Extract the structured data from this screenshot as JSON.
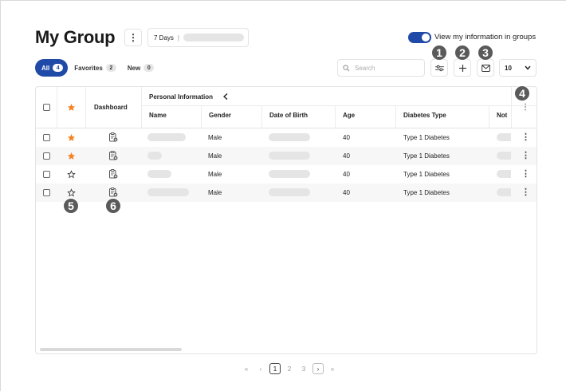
{
  "header": {
    "title": "My Group",
    "range_label": "7 Days",
    "range_separator": "|",
    "toggle_label": "View my information in groups",
    "toggle_on": true
  },
  "tabs": [
    {
      "label": "All",
      "count": "4",
      "active": true
    },
    {
      "label": "Favorites",
      "count": "2",
      "active": false
    },
    {
      "label": "New",
      "count": "0",
      "active": false
    }
  ],
  "toolbar": {
    "search_placeholder": "Search",
    "filter_icon": "sliders-icon",
    "add_icon": "plus-icon",
    "mail_icon": "mail-icon",
    "per_page": "10"
  },
  "callouts": [
    "1",
    "2",
    "3",
    "4",
    "5",
    "6"
  ],
  "table": {
    "group_header": "Personal Information",
    "columns": {
      "dashboard": "Dashboard",
      "name": "Name",
      "gender": "Gender",
      "dob": "Date of Birth",
      "age": "Age",
      "diabetes": "Diabetes Type",
      "note": "Not"
    },
    "rows": [
      {
        "favorite": true,
        "gender": "Male",
        "age": "40",
        "diabetes": "Type 1 Diabetes"
      },
      {
        "favorite": true,
        "gender": "Male",
        "age": "40",
        "diabetes": "Type 1 Diabetes"
      },
      {
        "favorite": false,
        "gender": "Male",
        "age": "40",
        "diabetes": "Type 1 Diabetes"
      },
      {
        "favorite": false,
        "gender": "Male",
        "age": "40",
        "diabetes": "Type 1 Diabetes"
      }
    ]
  },
  "pagination": {
    "first": "«",
    "prev": "‹",
    "pages": [
      "1",
      "2",
      "3"
    ],
    "current": "1",
    "next": "›",
    "last": "»"
  },
  "colors": {
    "accent": "#1f4aa8",
    "star": "#f58220",
    "callout": "#5a5a5a"
  }
}
